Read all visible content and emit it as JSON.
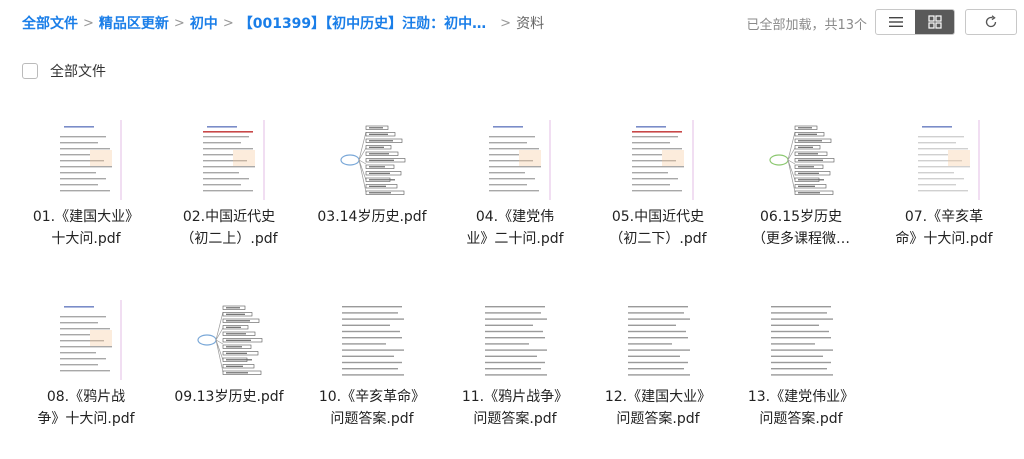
{
  "breadcrumb": {
    "items": [
      "全部文件",
      "精品区更新",
      "初中",
      "【001399】【初中历史】汪勋：初中…",
      "资料"
    ],
    "separator": ">"
  },
  "status": {
    "text": "已全部加载，共13个"
  },
  "toolbar": {
    "list_view_icon": "list-icon",
    "grid_view_icon": "grid-icon",
    "refresh_icon": "refresh-icon"
  },
  "select_all": {
    "label": "全部文件"
  },
  "colors": {
    "accent": "#1a7ee8",
    "text": "#222222",
    "muted": "#8a8a8a",
    "view_active": "#5a5a5a"
  },
  "files": [
    {
      "line1": "01.《建国大业》",
      "line2": "十大问.pdf",
      "thumb": "doc"
    },
    {
      "line1": "02.中国近代史",
      "line2": "（初二上）.pdf",
      "thumb": "doc-red"
    },
    {
      "line1": "03.14岁历史.pdf",
      "line2": "",
      "thumb": "mindmap"
    },
    {
      "line1": "04.《建党伟",
      "line2": "业》二十问.pdf",
      "thumb": "doc"
    },
    {
      "line1": "05.中国近代史",
      "line2": "（初二下）.pdf",
      "thumb": "doc-red"
    },
    {
      "line1": "06.15岁历史",
      "line2": "（更多课程微…",
      "thumb": "mindmap-green"
    },
    {
      "line1": "07.《辛亥革",
      "line2": "命》十大问.pdf",
      "thumb": "doc-light"
    },
    {
      "line1": "08.《鸦片战",
      "line2": "争》十大问.pdf",
      "thumb": "doc"
    },
    {
      "line1": "09.13岁历史.pdf",
      "line2": "",
      "thumb": "mindmap"
    },
    {
      "line1": "10.《辛亥革命》",
      "line2": "问题答案.pdf",
      "thumb": "text"
    },
    {
      "line1": "11.《鸦片战争》",
      "line2": "问题答案.pdf",
      "thumb": "text"
    },
    {
      "line1": "12.《建国大业》",
      "line2": "问题答案.pdf",
      "thumb": "text"
    },
    {
      "line1": "13.《建党伟业》",
      "line2": "问题答案.pdf",
      "thumb": "text"
    }
  ]
}
